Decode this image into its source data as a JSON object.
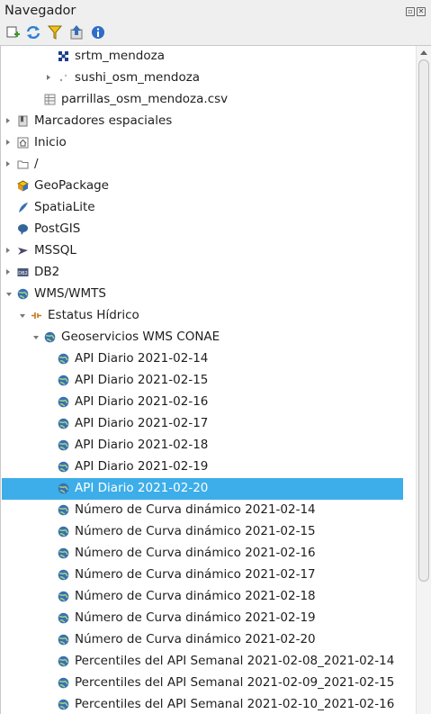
{
  "panel": {
    "title": "Navegador"
  },
  "toolbar": {
    "buttons": [
      "add-layer",
      "refresh",
      "filter",
      "collapse-all",
      "info"
    ]
  },
  "tree": [
    {
      "label": "srtm_mendoza",
      "icon": "raster-icon",
      "expander": "none",
      "level": 3,
      "selected": false
    },
    {
      "label": "sushi_osm_mendoza",
      "icon": "point-layer-icon",
      "expander": "right",
      "level": 3,
      "selected": false
    },
    {
      "label": "parrillas_osm_mendoza.csv",
      "icon": "table-icon",
      "expander": "none",
      "level": 2,
      "selected": false
    },
    {
      "label": "Marcadores espaciales",
      "icon": "bookmark-icon",
      "expander": "right",
      "level": 0,
      "selected": false
    },
    {
      "label": "Inicio",
      "icon": "home-icon",
      "expander": "right",
      "level": 0,
      "selected": false
    },
    {
      "label": "/",
      "icon": "folder-icon",
      "expander": "right",
      "level": 0,
      "selected": false
    },
    {
      "label": "GeoPackage",
      "icon": "geopackage-icon",
      "expander": "none",
      "level": 0,
      "selected": false
    },
    {
      "label": "SpatiaLite",
      "icon": "spatialite-icon",
      "expander": "none",
      "level": 0,
      "selected": false
    },
    {
      "label": "PostGIS",
      "icon": "postgis-icon",
      "expander": "none",
      "level": 0,
      "selected": false
    },
    {
      "label": "MSSQL",
      "icon": "mssql-icon",
      "expander": "right",
      "level": 0,
      "selected": false
    },
    {
      "label": "DB2",
      "icon": "db2-icon",
      "expander": "right",
      "level": 0,
      "selected": false
    },
    {
      "label": "WMS/WMTS",
      "icon": "globe-icon",
      "expander": "down",
      "level": 0,
      "selected": false
    },
    {
      "label": "Estatus Hídrico",
      "icon": "connection-icon",
      "expander": "down",
      "level": 1,
      "selected": false
    },
    {
      "label": "Geoservicios WMS CONAE",
      "icon": "globe-icon",
      "expander": "down",
      "level": 2,
      "selected": false
    },
    {
      "label": "API Diario 2021-02-14",
      "icon": "globe-icon",
      "expander": "none",
      "level": 3,
      "selected": false
    },
    {
      "label": "API Diario 2021-02-15",
      "icon": "globe-icon",
      "expander": "none",
      "level": 3,
      "selected": false
    },
    {
      "label": "API Diario 2021-02-16",
      "icon": "globe-icon",
      "expander": "none",
      "level": 3,
      "selected": false
    },
    {
      "label": "API Diario 2021-02-17",
      "icon": "globe-icon",
      "expander": "none",
      "level": 3,
      "selected": false
    },
    {
      "label": "API Diario 2021-02-18",
      "icon": "globe-icon",
      "expander": "none",
      "level": 3,
      "selected": false
    },
    {
      "label": "API Diario 2021-02-19",
      "icon": "globe-icon",
      "expander": "none",
      "level": 3,
      "selected": false
    },
    {
      "label": "API Diario 2021-02-20",
      "icon": "globe-icon",
      "expander": "none",
      "level": 3,
      "selected": true
    },
    {
      "label": "Número de Curva dinámico 2021-02-14",
      "icon": "globe-icon",
      "expander": "none",
      "level": 3,
      "selected": false
    },
    {
      "label": "Número de Curva dinámico 2021-02-15",
      "icon": "globe-icon",
      "expander": "none",
      "level": 3,
      "selected": false
    },
    {
      "label": "Número de Curva dinámico 2021-02-16",
      "icon": "globe-icon",
      "expander": "none",
      "level": 3,
      "selected": false
    },
    {
      "label": "Número de Curva dinámico 2021-02-17",
      "icon": "globe-icon",
      "expander": "none",
      "level": 3,
      "selected": false
    },
    {
      "label": "Número de Curva dinámico 2021-02-18",
      "icon": "globe-icon",
      "expander": "none",
      "level": 3,
      "selected": false
    },
    {
      "label": "Número de Curva dinámico 2021-02-19",
      "icon": "globe-icon",
      "expander": "none",
      "level": 3,
      "selected": false
    },
    {
      "label": "Número de Curva dinámico 2021-02-20",
      "icon": "globe-icon",
      "expander": "none",
      "level": 3,
      "selected": false
    },
    {
      "label": "Percentiles del API Semanal 2021-02-08_2021-02-14",
      "icon": "globe-icon",
      "expander": "none",
      "level": 3,
      "selected": false
    },
    {
      "label": "Percentiles del API Semanal 2021-02-09_2021-02-15",
      "icon": "globe-icon",
      "expander": "none",
      "level": 3,
      "selected": false
    },
    {
      "label": "Percentiles del API Semanal 2021-02-10_2021-02-16",
      "icon": "globe-icon",
      "expander": "none",
      "level": 3,
      "selected": false
    }
  ],
  "colors": {
    "selection": "#3daee9",
    "globe": "#3a6fb5",
    "refresh": "#2a7fd4",
    "filter": "#e8b100"
  }
}
